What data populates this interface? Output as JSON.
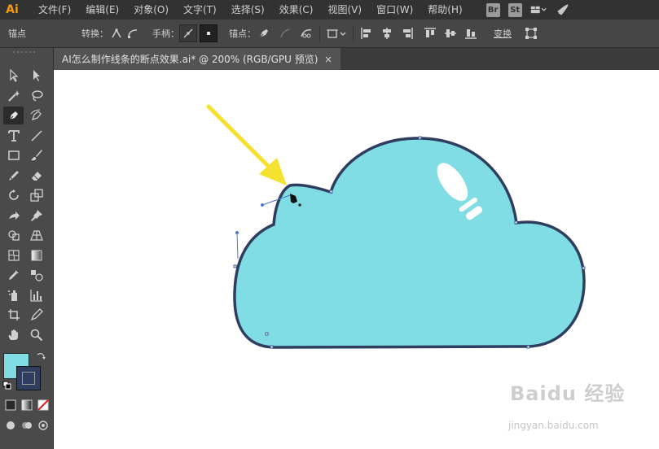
{
  "app": {
    "logo": "Ai"
  },
  "menu": [
    {
      "label": "文件(F)"
    },
    {
      "label": "编辑(E)"
    },
    {
      "label": "对象(O)"
    },
    {
      "label": "文字(T)"
    },
    {
      "label": "选择(S)"
    },
    {
      "label": "效果(C)"
    },
    {
      "label": "视图(V)"
    },
    {
      "label": "窗口(W)"
    },
    {
      "label": "帮助(H)"
    }
  ],
  "menubar_right": {
    "bridge_badge": "Br",
    "stock_badge": "St"
  },
  "controlbar": {
    "tool_name": "锚点",
    "convert_label": "转换：",
    "handles_label": "手柄：",
    "anchor_label": "锚点：",
    "transform_label": "变换"
  },
  "document": {
    "tab_title": "AI怎么制作线条的断点效果.ai* @ 200% (RGB/GPU 预览)",
    "close_glyph": "×"
  },
  "colors": {
    "cloud_fill": "#7fdde3",
    "cloud_stroke": "#2f3d5f",
    "arrow": "#f5e12f",
    "fill_swatch": "#7fdde3",
    "stroke_swatch": "#2f3d5f"
  },
  "watermark": {
    "text": "Baidu 经验",
    "url": "jingyan.baidu.com"
  }
}
